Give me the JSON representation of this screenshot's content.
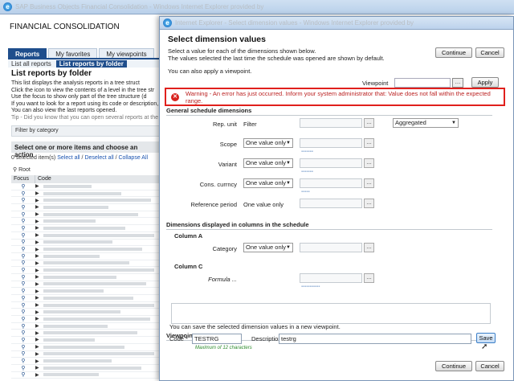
{
  "background": {
    "window_title": "SAP Business Objects Financial Consolidation - Windows Internet Explorer provided by",
    "app_title": "FINANCIAL CONSOLIDATION",
    "tabs": [
      "Reports",
      "My favorites",
      "My viewpoints"
    ],
    "subtabs": [
      "List all reports",
      "List reports by folder"
    ],
    "heading": "List reports by folder",
    "desc_lines": [
      "This list displays the analysis reports in a tree struct",
      "Click the icon to view the contents of a level in the tree str",
      "Use the focus to show only part of the tree structure (d",
      "If you want to look for a report using its code or description,",
      "You can also view the last reports opened."
    ],
    "tip": "Tip - Did you know that you can open several reports at the s",
    "filter_label": "Filter by category",
    "select_heading": "Select one or more items and choose an action",
    "selection_count": "0 selected item(s)",
    "select_all": "Select all",
    "deselect_all": "Deselect all",
    "collapse_all": "Collapse All",
    "root_label": "Root",
    "columns": [
      "Focus",
      "Code"
    ]
  },
  "dialog": {
    "window_title": "Internet Explorer - Select dimension values - Windows Internet Explorer provided by",
    "heading": "Select dimension values",
    "desc_line1": "Select a value for each of the dimensions shown below.",
    "desc_line2": "The values selected the last time the schedule was opened are shown by default.",
    "desc_line3": "You can also apply a viewpoint.",
    "continue_label": "Continue",
    "cancel_label": "Cancel",
    "viewpoint_label": "Viewpoint",
    "apply_label": "Apply",
    "error_message": "Warning - An error has just occurred. Inform your system administrator that: Value does not fall within the expected range.",
    "section_general": "General schedule dimensions",
    "rep_unit_label": "Rep. unit",
    "rep_unit_value": "Filter",
    "aggregated_value": "Aggregated",
    "scope_label": "Scope",
    "variant_label": "Variant",
    "cons_currcy_label": "Cons. currncy",
    "one_value_only": "One value only",
    "reference_period_label": "Reference period",
    "section_columns": "Dimensions displayed in columns in the schedule",
    "column_a_label": "Column A",
    "category_label": "Category",
    "column_c_label": "Column C",
    "formula_label": "Formula ...",
    "section_viewpoint": "Viewpoint",
    "viewpoint_desc": "You can save the selected dimension values in a new viewpoint.",
    "code_label": "Code *",
    "code_value": "TESTRG",
    "code_hint": "Maximum of 12 characters",
    "description_label": "Description",
    "description_value": "testrg",
    "save_label": "Save"
  }
}
